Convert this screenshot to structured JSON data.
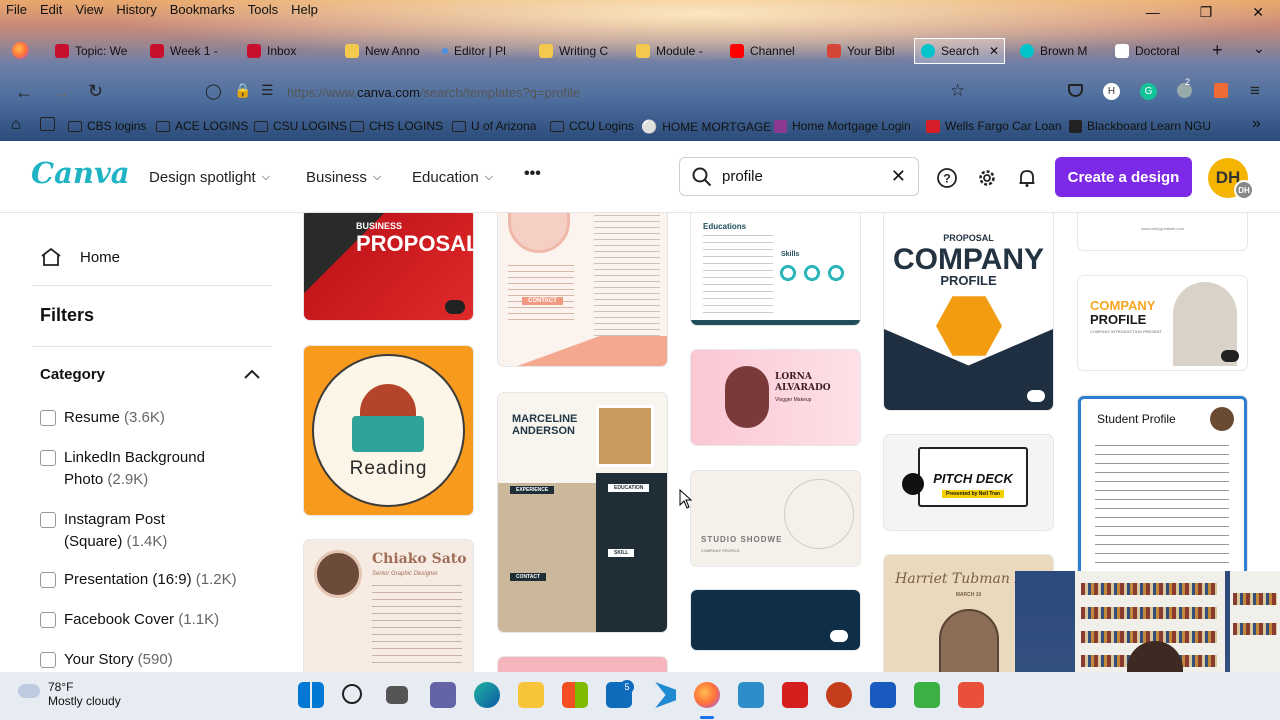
{
  "browser": {
    "menu": [
      "File",
      "Edit",
      "View",
      "History",
      "Bookmarks",
      "Tools",
      "Help"
    ],
    "tabs": [
      {
        "label": "Topic: We",
        "color": "#c8102e"
      },
      {
        "label": "Week 1 -",
        "color": "#c8102e"
      },
      {
        "label": "Inbox",
        "color": "#c8102e"
      },
      {
        "label": "New Anno",
        "color": "#f2c94c"
      },
      {
        "label": "Editor | Pl",
        "color": "#4a90e2"
      },
      {
        "label": "Writing C",
        "color": "#f2c94c"
      },
      {
        "label": "Module -",
        "color": "#f2c94c"
      },
      {
        "label": "Channel",
        "color": "#ff0000"
      },
      {
        "label": "Your Bibl",
        "color": "#d44638"
      },
      {
        "label": "Search",
        "color": "#00c4cc"
      },
      {
        "label": "Brown M",
        "color": "#00c4cc"
      },
      {
        "label": "Doctoral",
        "color": "#ffffff"
      }
    ],
    "url_prefix": "https://www.",
    "url_domain": "canva.com",
    "url_path": "/search/templates?q=profile",
    "ext_badge": "2",
    "bookmarks": [
      "CBS logins",
      "ACE LOGINS",
      "CSU LOGINS",
      "CHS LOGINS",
      "U of Arizona",
      "CCU Logins",
      "HOME MORTGAGE",
      "Home Mortgage Login",
      "Wells Fargo Car Loan",
      "Blackboard Learn NGU"
    ]
  },
  "canva": {
    "logo": "Canva",
    "nav": [
      "Design spotlight",
      "Business",
      "Education"
    ],
    "more": "•••",
    "search_value": "profile",
    "create_label": "Create a design",
    "avatar": "DH",
    "avatar_mini": "DH"
  },
  "sidebar": {
    "home": "Home",
    "filters": "Filters",
    "category": "Category",
    "items": [
      {
        "label": "Resume",
        "count": "(3.6K)"
      },
      {
        "label": "LinkedIn Background Photo",
        "count": "(2.9K)"
      },
      {
        "label": "Instagram Post (Square)",
        "count": "(1.4K)"
      },
      {
        "label": "Presentation (16:9)",
        "count": "(1.2K)"
      },
      {
        "label": "Facebook Cover",
        "count": "(1.1K)"
      },
      {
        "label": "Your Story",
        "count": "(590)"
      }
    ]
  },
  "templates": {
    "business_top": "BUSINESS",
    "business": "PROPOSAL",
    "resume_contact": "CONTACT",
    "edu_title": "Educations",
    "edu_skills": "Skills",
    "proposal_small": "PROPOSAL",
    "company": "COMPANY",
    "profile": "PROFILE",
    "reading": "Reading",
    "lorna": "LORNA ALVARADO",
    "lorna_sub": "Vlogger Makeup",
    "company2": "COMPANY",
    "profile2": "PROFILE",
    "company2_sub": "COMPANY INTRODUCTION PRESENT",
    "marceline": "MARCELINE ANDERSON",
    "experience": "EXPERIENCE",
    "education": "EDUCATION",
    "contact": "CONTACT",
    "skill": "SKILL",
    "studio": "STUDIO SHODWE",
    "studio_sub": "COMPANY PROFILE",
    "pitch": "PITCH DECK",
    "pitch_sub": "Presented by Neil Tran",
    "student": "Student Profile",
    "chiako": "Chiako Sato",
    "chiako_sub": "Senior Graphic Designer",
    "harriet": "Harriet Tubman Day",
    "harriet_sub": "MARCH 10",
    "website": "www.reallygreatsite.com"
  },
  "taskbar": {
    "temp": "78°F",
    "cond": "Mostly cloudy",
    "badge": "5"
  }
}
